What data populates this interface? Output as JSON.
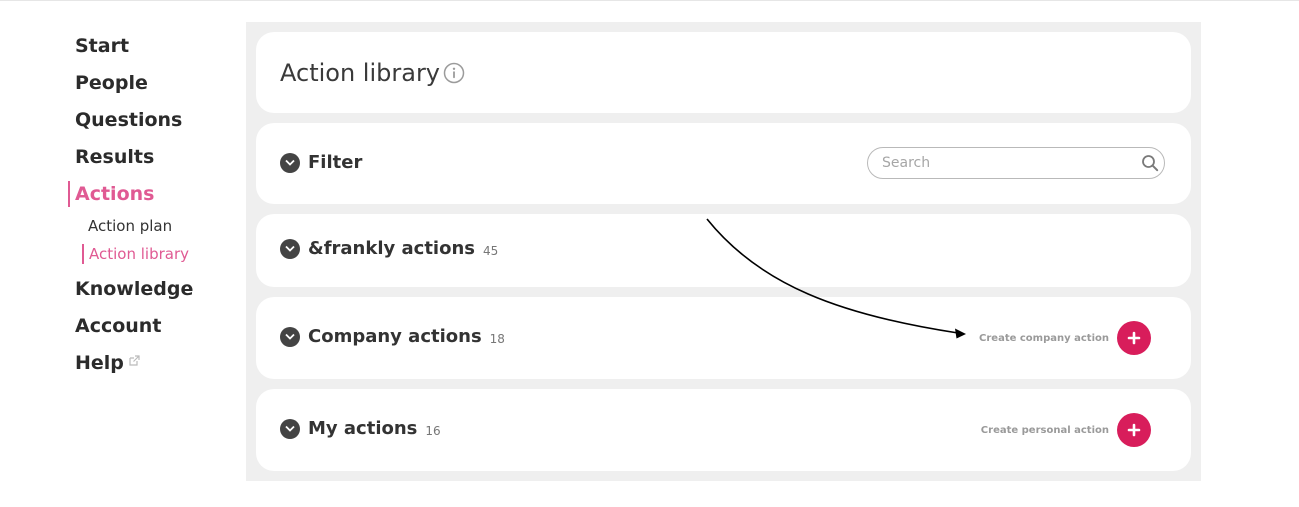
{
  "sidebar": {
    "items": [
      {
        "label": "Start"
      },
      {
        "label": "People"
      },
      {
        "label": "Questions"
      },
      {
        "label": "Results"
      },
      {
        "label": "Actions"
      },
      {
        "label": "Knowledge"
      },
      {
        "label": "Account"
      },
      {
        "label": "Help"
      }
    ],
    "actions_sub": [
      {
        "label": "Action plan"
      },
      {
        "label": "Action library"
      }
    ]
  },
  "header": {
    "title": "Action library"
  },
  "filter": {
    "label": "Filter",
    "search_placeholder": "Search"
  },
  "sections": {
    "frankly": {
      "label": "&frankly actions",
      "count": "45"
    },
    "company": {
      "label": "Company actions",
      "count": "18",
      "create_label": "Create company action"
    },
    "mine": {
      "label": "My actions",
      "count": "16",
      "create_label": "Create personal action"
    }
  },
  "colors": {
    "accent": "#e05a93",
    "create_button": "#d81d5b",
    "panel_bg": "#efefef"
  }
}
